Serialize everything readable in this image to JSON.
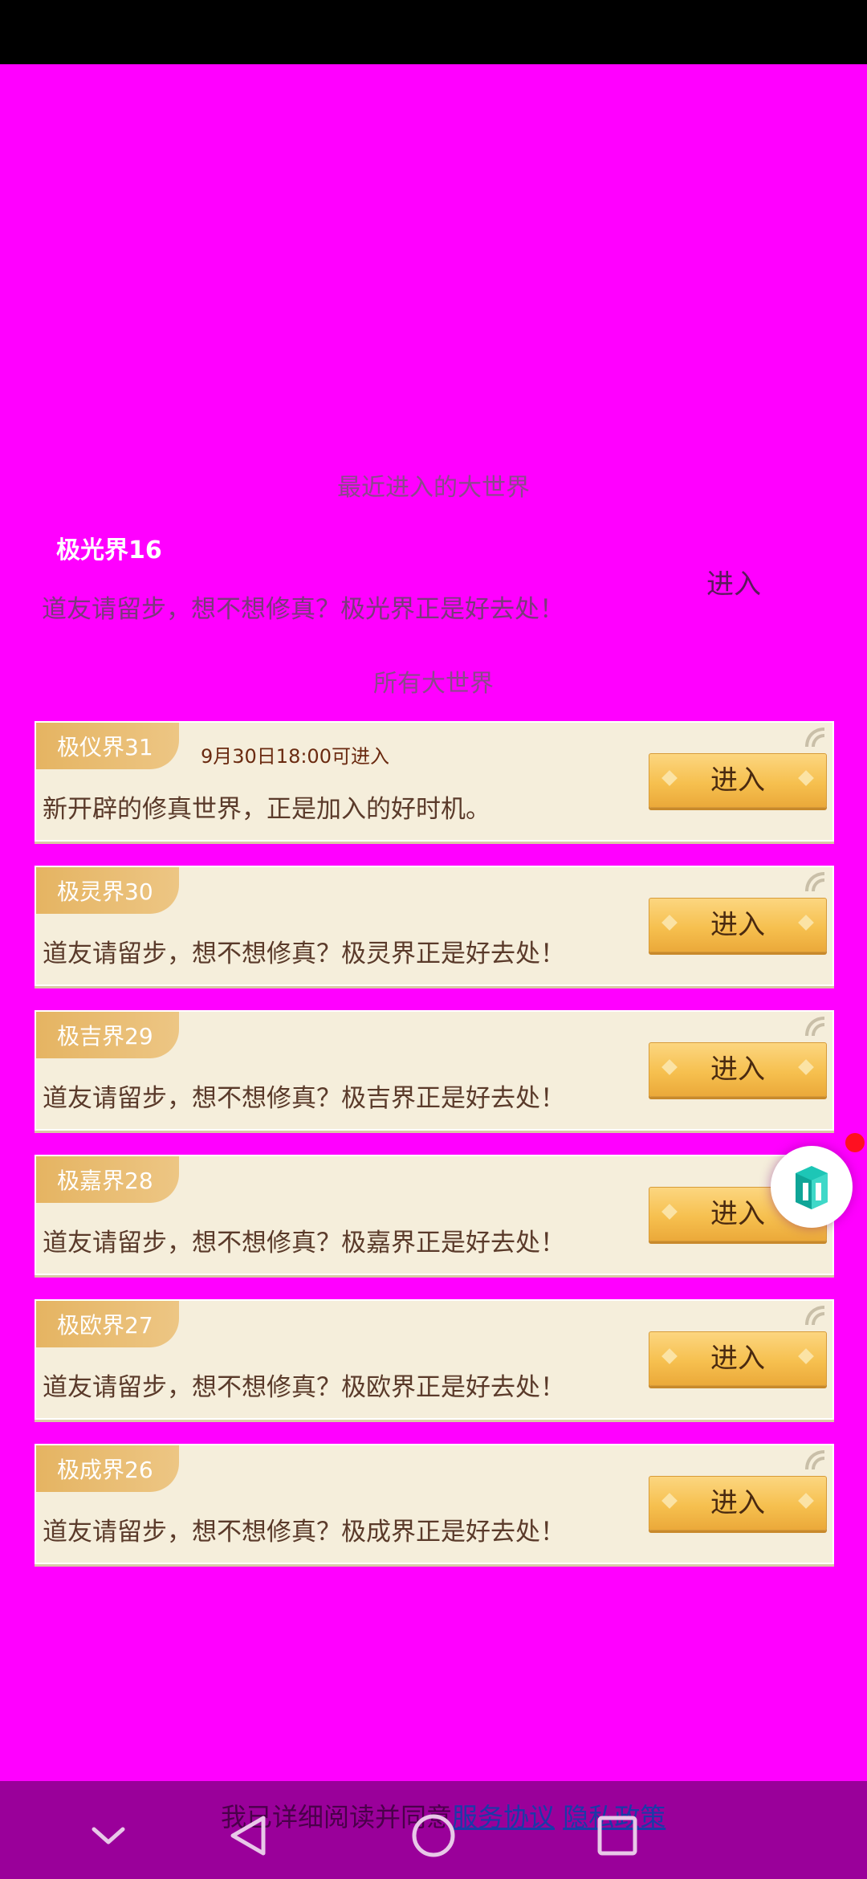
{
  "recent": {
    "section_title": "最近进入的大世界",
    "name": "极光界16",
    "description": "道友请留步，想不想修真？极光界正是好去处！",
    "enter_label": "进入"
  },
  "all_section_title": "所有大世界",
  "worlds": [
    {
      "name": "极仪界31",
      "note": "9月30日18:00可进入",
      "description": "新开辟的修真世界，正是加入的好时机。",
      "enter_label": "进入"
    },
    {
      "name": "极灵界30",
      "note": "",
      "description": "道友请留步，想不想修真？极灵界正是好去处！",
      "enter_label": "进入"
    },
    {
      "name": "极吉界29",
      "note": "",
      "description": "道友请留步，想不想修真？极吉界正是好去处！",
      "enter_label": "进入"
    },
    {
      "name": "极嘉界28",
      "note": "",
      "description": "道友请留步，想不想修真？极嘉界正是好去处！",
      "enter_label": "进入"
    },
    {
      "name": "极欧界27",
      "note": "",
      "description": "道友请留步，想不想修真？极欧界正是好去处！",
      "enter_label": "进入"
    },
    {
      "name": "极成界26",
      "note": "",
      "description": "道友请留步，想不想修真？极成界正是好去处！",
      "enter_label": "进入"
    }
  ],
  "agreement": {
    "prefix": "我已详细阅读并同意",
    "service_link": "服务协议",
    "privacy_link": "隐私政策"
  },
  "colors": {
    "background": "#ff00ff",
    "card": "#f5eedb",
    "tab": "#e5b462",
    "button": "#f6c04f",
    "nav_bar": "#9a009a"
  },
  "icons": {
    "floating": "cube-icon",
    "nav": [
      "chevron-down-icon",
      "back-triangle-icon",
      "home-circle-icon",
      "recents-square-icon"
    ]
  }
}
